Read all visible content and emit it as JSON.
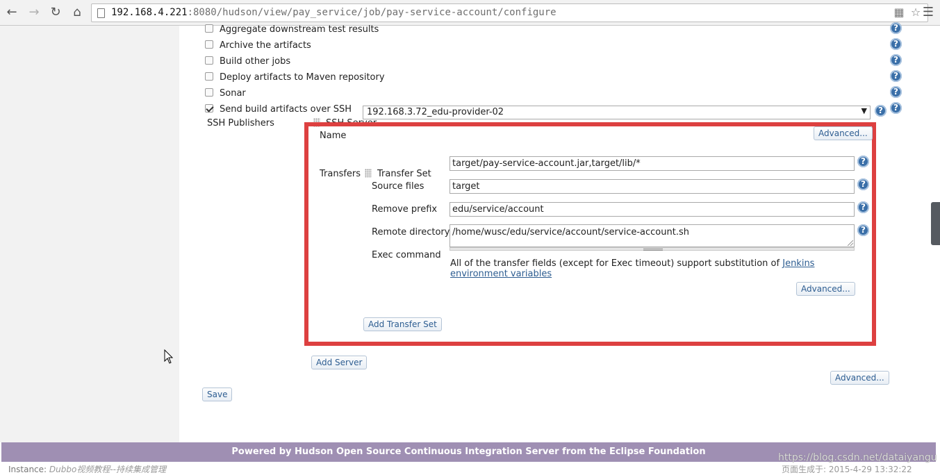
{
  "browser": {
    "url_host": "192.168.4.221",
    "url_rest": ":8080/hudson/view/pay_service/job/pay-service-account/configure",
    "icons": [
      "back-icon",
      "forward-icon",
      "reload-icon",
      "home-icon",
      "page-icon",
      "translate-icon",
      "star-icon",
      "menu-icon"
    ]
  },
  "post_build": {
    "options": [
      {
        "label": "Aggregate downstream test results",
        "checked": false
      },
      {
        "label": "Archive the artifacts",
        "checked": false
      },
      {
        "label": "Build other jobs",
        "checked": false
      },
      {
        "label": "Deploy artifacts to Maven repository",
        "checked": false
      },
      {
        "label": "Sonar",
        "checked": false
      },
      {
        "label": "Send build artifacts over SSH",
        "checked": true
      }
    ]
  },
  "ssh": {
    "publishers_label": "SSH Publishers",
    "server_label": "SSH Server",
    "name_label": "Name",
    "name_value": "192.168.3.72_edu-provider-02",
    "advanced_label": "Advanced...",
    "transfers_label": "Transfers",
    "transfer_set_label": "Transfer Set",
    "source_files_label": "Source files",
    "source_files_value": "target/pay-service-account.jar,target/lib/*",
    "remove_prefix_label": "Remove prefix",
    "remove_prefix_value": "target",
    "remote_directory_label": "Remote directory",
    "remote_directory_value": "edu/service/account",
    "exec_command_label": "Exec command",
    "exec_command_value": "/home/wusc/edu/service/account/service-account.sh",
    "note_text": "All of the transfer fields (except for Exec timeout) support substitution of ",
    "note_link": "Jenkins environment variables",
    "transfer_advanced_label": "Advanced...",
    "add_transfer_set_label": "Add Transfer Set",
    "add_server_label": "Add Server",
    "publisher_advanced_label": "Advanced..."
  },
  "save_label": "Save",
  "footer": {
    "powered_by": "Powered by Hudson Open Source Continuous Integration Server from the Eclipse Foundation",
    "instance_label": "Instance: ",
    "instance_value": "Dubbo视频教程--持续集成管理",
    "watermark": "https://blog.csdn.net/dataiyangu",
    "generated": "页面生成于: 2015-4-29 13:32:22"
  }
}
